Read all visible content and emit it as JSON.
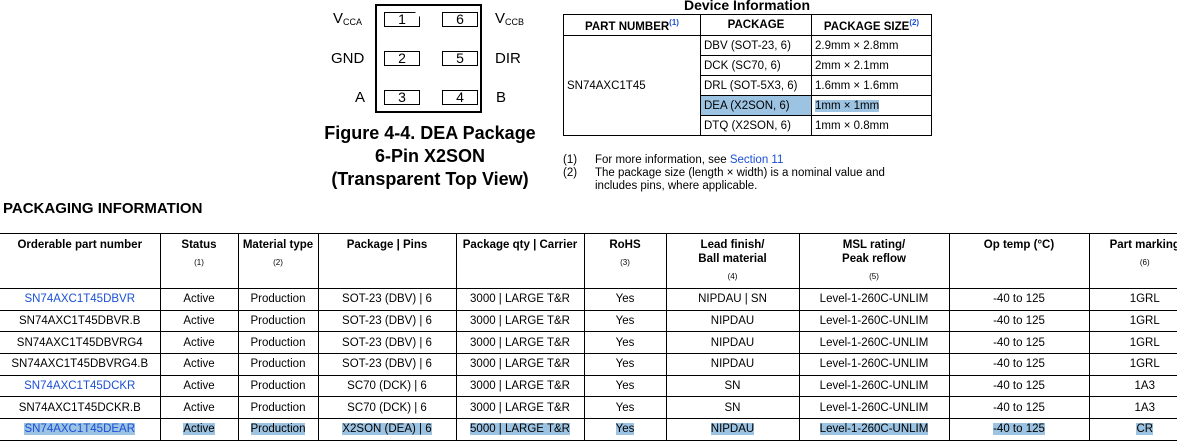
{
  "figure": {
    "pins": [
      {
        "num": "1",
        "label": "V",
        "sub": "CCA",
        "side": "left"
      },
      {
        "num": "2",
        "label": "GND",
        "sub": "",
        "side": "left"
      },
      {
        "num": "3",
        "label": "A",
        "sub": "",
        "side": "left"
      },
      {
        "num": "6",
        "label": "V",
        "sub": "CCB",
        "side": "right"
      },
      {
        "num": "5",
        "label": "DIR",
        "sub": "",
        "side": "right"
      },
      {
        "num": "4",
        "label": "B",
        "sub": "",
        "side": "right"
      }
    ],
    "caption_line1": "Figure 4-4. DEA Package",
    "caption_line2": "6-Pin X2SON",
    "caption_line3": "(Transparent Top View)"
  },
  "device_info": {
    "title": "Device Information",
    "headers": [
      "PART NUMBER",
      "PACKAGE",
      "PACKAGE SIZE"
    ],
    "header_notes": [
      "(1)",
      "",
      "(2)"
    ],
    "part_number": "SN74AXC1T45",
    "rows": [
      {
        "package": "DBV (SOT-23, 6)",
        "size": "2.9mm × 2.8mm"
      },
      {
        "package": "DCK (SC70, 6)",
        "size": "2mm × 2.1mm"
      },
      {
        "package": "DRL (SOT-5X3, 6)",
        "size": "1.6mm × 1.6mm"
      },
      {
        "package": "DEA (X2SON, 6)",
        "size": "1mm × 1mm"
      },
      {
        "package": "DTQ (X2SON, 6)",
        "size": "1mm × 0.8mm"
      }
    ],
    "highlighted_row": 3,
    "notes": [
      {
        "marker": "(1)",
        "text": "For more information, see ",
        "link": "Section 11"
      },
      {
        "marker": "(2)",
        "text": "The package size (length × width) is a nominal value and",
        "text2": "includes pins, where applicable."
      }
    ]
  },
  "packaging": {
    "title": "PACKAGING INFORMATION",
    "columns": [
      {
        "label": "Orderable part number",
        "label2": "",
        "note": ""
      },
      {
        "label": "Status",
        "label2": "",
        "note": "(1)"
      },
      {
        "label": "Material type",
        "label2": "",
        "note": "(2)"
      },
      {
        "label": "Package | Pins",
        "label2": "",
        "note": ""
      },
      {
        "label": "Package qty | Carrier",
        "label2": "",
        "note": ""
      },
      {
        "label": "RoHS",
        "label2": "",
        "note": "(3)"
      },
      {
        "label": "Lead finish/",
        "label2": "Ball material",
        "note": "(4)"
      },
      {
        "label": "MSL rating/",
        "label2": "Peak reflow",
        "note": "(5)"
      },
      {
        "label": "Op temp (°C)",
        "label2": "",
        "note": ""
      },
      {
        "label": "Part marking",
        "label2": "",
        "note": "(6)"
      }
    ],
    "rows": [
      {
        "part": "SN74AXC1T45DBVR",
        "link": true,
        "status": "Active",
        "material": "Production",
        "pkg": "SOT-23 (DBV) | 6",
        "qty": "3000 | LARGE T&R",
        "rohs": "Yes",
        "finish": "NIPDAU | SN",
        "msl": "Level-1-260C-UNLIM",
        "temp": "-40 to 125",
        "marking": "1GRL"
      },
      {
        "part": "SN74AXC1T45DBVR.B",
        "link": false,
        "status": "Active",
        "material": "Production",
        "pkg": "SOT-23 (DBV) | 6",
        "qty": "3000 | LARGE T&R",
        "rohs": "Yes",
        "finish": "NIPDAU",
        "msl": "Level-1-260C-UNLIM",
        "temp": "-40 to 125",
        "marking": "1GRL"
      },
      {
        "part": "SN74AXC1T45DBVRG4",
        "link": false,
        "status": "Active",
        "material": "Production",
        "pkg": "SOT-23 (DBV) | 6",
        "qty": "3000 | LARGE T&R",
        "rohs": "Yes",
        "finish": "NIPDAU",
        "msl": "Level-1-260C-UNLIM",
        "temp": "-40 to 125",
        "marking": "1GRL"
      },
      {
        "part": "SN74AXC1T45DBVRG4.B",
        "link": false,
        "status": "Active",
        "material": "Production",
        "pkg": "SOT-23 (DBV) | 6",
        "qty": "3000 | LARGE T&R",
        "rohs": "Yes",
        "finish": "NIPDAU",
        "msl": "Level-1-260C-UNLIM",
        "temp": "-40 to 125",
        "marking": "1GRL"
      },
      {
        "part": "SN74AXC1T45DCKR",
        "link": true,
        "status": "Active",
        "material": "Production",
        "pkg": "SC70 (DCK) | 6",
        "qty": "3000 | LARGE T&R",
        "rohs": "Yes",
        "finish": "SN",
        "msl": "Level-1-260C-UNLIM",
        "temp": "-40 to 125",
        "marking": "1A3"
      },
      {
        "part": "SN74AXC1T45DCKR.B",
        "link": false,
        "status": "Active",
        "material": "Production",
        "pkg": "SC70 (DCK) | 6",
        "qty": "3000 | LARGE T&R",
        "rohs": "Yes",
        "finish": "SN",
        "msl": "Level-1-260C-UNLIM",
        "temp": "-40 to 125",
        "marking": "1A3"
      },
      {
        "part": "SN74AXC1T45DEAR",
        "link": true,
        "status": "Active",
        "material": "Production",
        "pkg": "X2SON (DEA) | 6",
        "qty": "5000 | LARGE T&R",
        "rohs": "Yes",
        "finish": "NIPDAU",
        "msl": "Level-1-260C-UNLIM",
        "temp": "-40 to 125",
        "marking": "CR"
      }
    ],
    "highlighted_row": 6
  },
  "colors": {
    "link": "#1a4fd6",
    "highlight": "#9dc3e2"
  }
}
